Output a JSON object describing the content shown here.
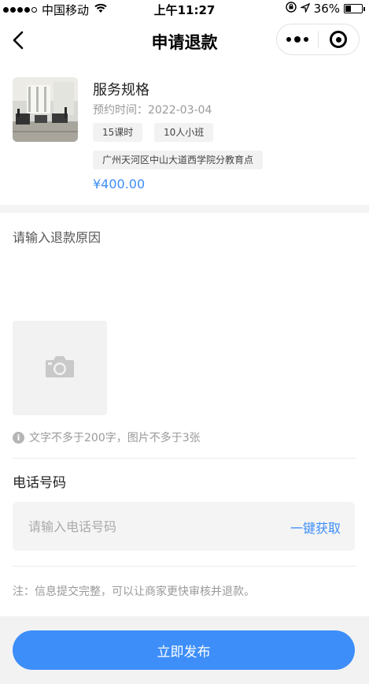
{
  "status_bar": {
    "carrier": "中国移动",
    "time": "上午11:27",
    "battery_text": "36%",
    "battery_level": 0.36
  },
  "nav": {
    "title": "申请退款"
  },
  "product": {
    "name": "服务规格",
    "date": "预约时间：2022-03-04",
    "tags": [
      "15课时",
      "10人小班"
    ],
    "address": "广州天河区中山大道西学院分教育点",
    "price": "¥400.00"
  },
  "reason": {
    "placeholder": "请输入退款原因",
    "hint": "文字不多于200字，图片不多于3张"
  },
  "phone": {
    "label": "电话号码",
    "placeholder": "请输入电话号码",
    "get_label": "一键获取"
  },
  "note": "注：信息提交完整，可以让商家更快审核并退款。",
  "submit_label": "立即发布",
  "colors": {
    "accent": "#3d8ef8",
    "footer_bg": "#f2f2f2"
  }
}
